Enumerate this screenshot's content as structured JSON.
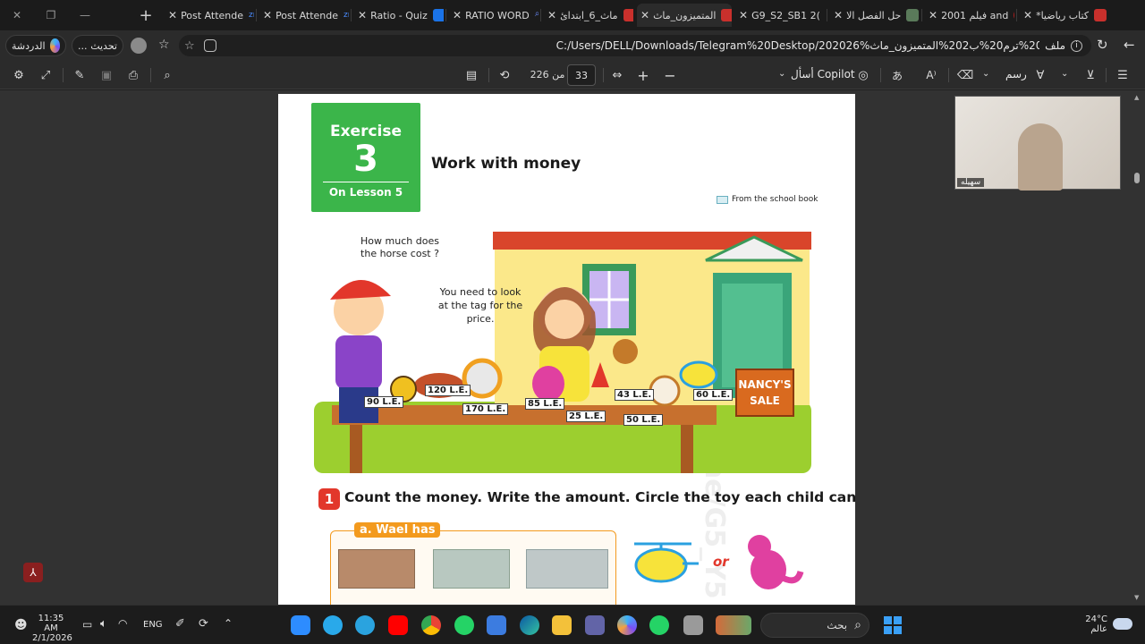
{
  "tabs": [
    {
      "label": "Post Attende",
      "badge": "zm"
    },
    {
      "label": "Post Attende",
      "badge": "zm"
    },
    {
      "label": "Ratio - Quiz"
    },
    {
      "label": "RATIO WORD"
    },
    {
      "label": "ماث_6_ابتدائ"
    },
    {
      "label": "المتميزون_ماث",
      "active": true
    },
    {
      "label": "G9_S2_SB1 2("
    },
    {
      "label": "حل الفصل الا"
    },
    {
      "label": "فيلم 2001 and"
    },
    {
      "label": "*كتاب رياضيا"
    }
  ],
  "addressbar": {
    "chat_label": "الدردشة",
    "update_label": "تحديث",
    "more_label": "...",
    "url": "C:/Users/DELL/Downloads/Telegram%20Desktop/202026%تاني20%ترم20%ب202%المتميزون_ماث.pdf",
    "file_label": "ملف"
  },
  "pdf_toolbar": {
    "page_current": "33",
    "page_of": "من 226",
    "copilot_label": "أسأل Copilot",
    "draw_label": "رسم"
  },
  "webcam": {
    "name": "سهيله"
  },
  "page": {
    "exercise_word": "Exercise",
    "exercise_number": "3",
    "exercise_lesson": "On Lesson 5",
    "title": "Work with money",
    "source": "From the school book",
    "watermark": "https://t.me/G5_Y5",
    "bubble_boy": "How much does the horse cost ?",
    "bubble_girl": "You need to look at the tag for the price.",
    "sign": "NANCY'S SALE",
    "tags": [
      "90 L.E.",
      "120 L.E.",
      "170 L.E.",
      "85 L.E.",
      "25 L.E.",
      "43 L.E.",
      "50 L.E.",
      "60 L.E."
    ],
    "question_number": "1",
    "question": "Count the money. Write the amount. Circle the toy each child can buy.",
    "part_a": "a. Wael has",
    "or_label": "or"
  },
  "taskbar": {
    "time": "11:35 AM",
    "date": "2/1/2026",
    "lang": "ENG",
    "search_label": "بحث",
    "weather_temp": "24°C",
    "weather_label": "عالم"
  },
  "colors": {
    "green": "#3bb54a",
    "orange": "#f39a1e",
    "red": "#e2372b"
  }
}
